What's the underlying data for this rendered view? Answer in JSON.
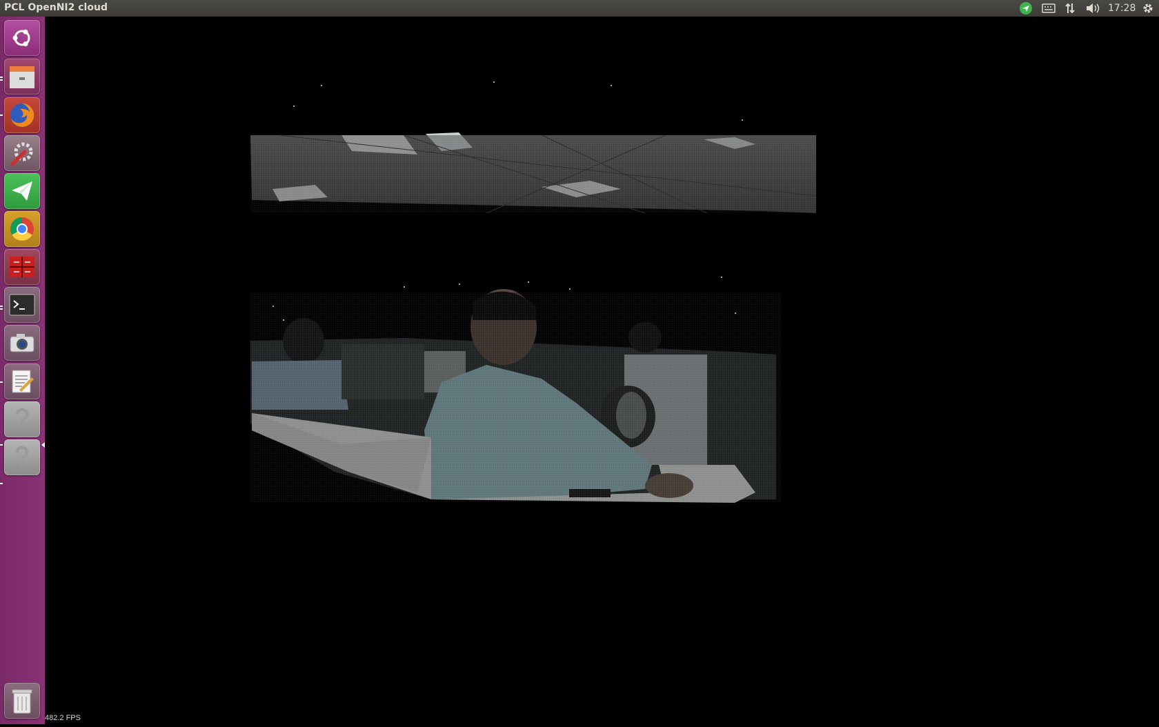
{
  "window": {
    "title": "PCL OpenNI2 cloud"
  },
  "panel": {
    "clock": "17:28"
  },
  "launcher": {
    "items": [
      {
        "name": "ubuntu-dash-icon"
      },
      {
        "name": "files-icon"
      },
      {
        "name": "firefox-icon"
      },
      {
        "name": "system-settings-icon"
      },
      {
        "name": "telegram-icon"
      },
      {
        "name": "chrome-icon"
      },
      {
        "name": "red-app-icon"
      },
      {
        "name": "terminal-icon"
      },
      {
        "name": "screenshot-camera-icon"
      },
      {
        "name": "text-editor-icon"
      },
      {
        "name": "unknown-app-icon"
      },
      {
        "name": "unknown-app-icon"
      },
      {
        "name": "trash-icon"
      }
    ]
  },
  "viewer": {
    "fps_text": "482.2 FPS",
    "background": "#000000"
  },
  "colors": {
    "launcher_bg": "#7b2a69",
    "panel_bg": "#3c3b37",
    "telegram_green": "#3fb34f"
  }
}
